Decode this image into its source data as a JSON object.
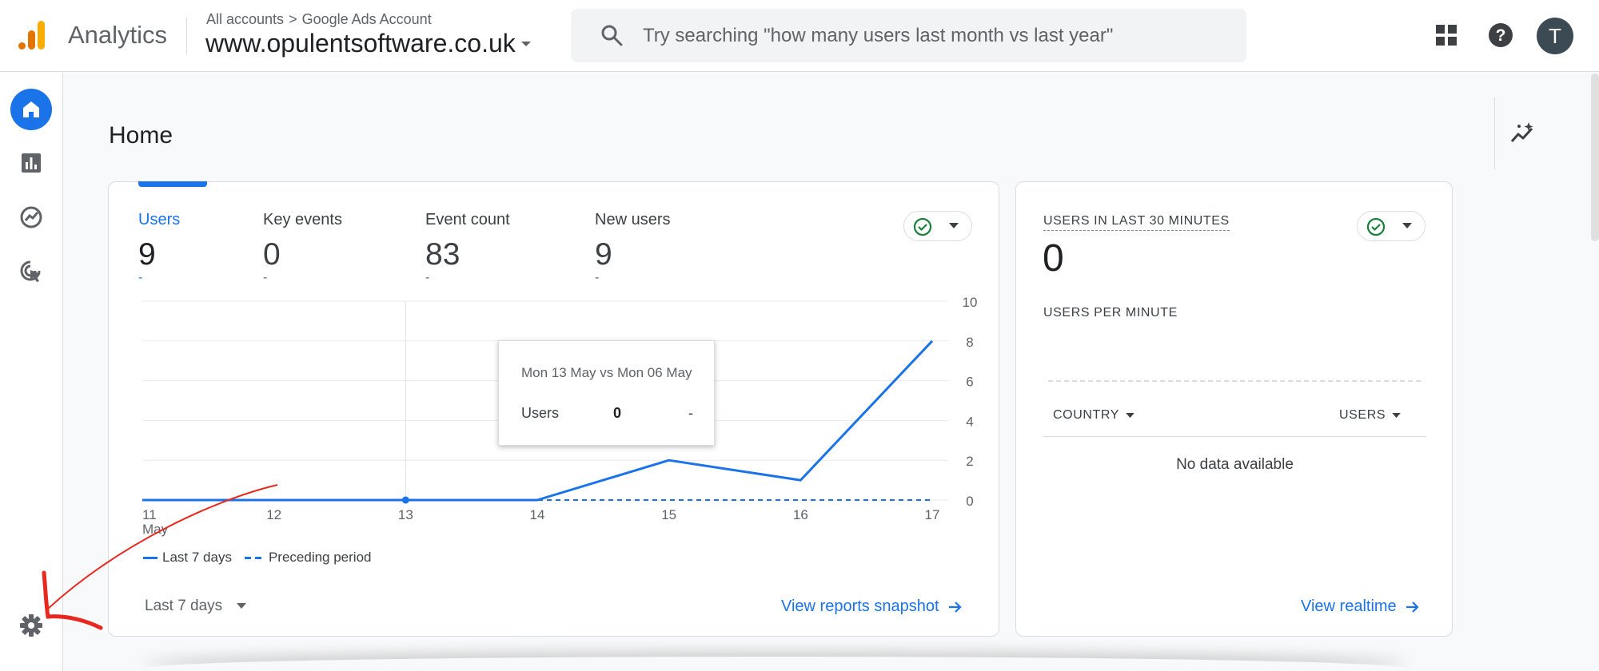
{
  "header": {
    "app_name": "Analytics",
    "breadcrumb_root": "All accounts",
    "breadcrumb_sep": ">",
    "breadcrumb_account": "Google Ads Account",
    "property": "www.opulentsoftware.co.uk",
    "search_placeholder": "Try searching \"how many users last month vs last year\"",
    "avatar_initial": "T",
    "icons": [
      "search-icon",
      "apps-grid-icon",
      "help-icon"
    ]
  },
  "leftnav": {
    "items": [
      {
        "icon": "home-icon",
        "active": true
      },
      {
        "icon": "reports-icon",
        "active": false
      },
      {
        "icon": "explore-icon",
        "active": false
      },
      {
        "icon": "advertising-icon",
        "active": false
      }
    ],
    "settings_icon": "gear-icon"
  },
  "page": {
    "title": "Home"
  },
  "main_card": {
    "metrics": [
      {
        "label": "Users",
        "value": "9",
        "delta": "-",
        "active": true
      },
      {
        "label": "Key events",
        "value": "0",
        "delta": "-",
        "active": false
      },
      {
        "label": "Event count",
        "value": "83",
        "delta": "-",
        "active": false
      },
      {
        "label": "New users",
        "value": "9",
        "delta": "-",
        "active": false
      }
    ],
    "tooltip": {
      "title": "Mon 13 May vs Mon 06 May",
      "row_label": "Users",
      "row_value": "0",
      "row_prev": "-"
    },
    "legend": {
      "current": "Last 7 days",
      "previous": "Preceding period"
    },
    "date_range": "Last 7 days",
    "link": "View reports snapshot"
  },
  "chart_data": {
    "type": "line",
    "x": [
      "11",
      "12",
      "13",
      "14",
      "15",
      "16",
      "17"
    ],
    "x_sublabel_first": "May",
    "y_ticks": [
      0,
      2,
      4,
      6,
      8,
      10
    ],
    "ylim": [
      0,
      10
    ],
    "series": [
      {
        "name": "Last 7 days",
        "values": [
          0,
          0,
          0,
          0,
          2,
          1,
          8
        ],
        "style": "solid",
        "color": "#1a73e8"
      },
      {
        "name": "Preceding period",
        "values": [
          0,
          0,
          0,
          0,
          0,
          0,
          0
        ],
        "style": "dashed",
        "color": "#1a73e8"
      }
    ],
    "highlight_index": 2
  },
  "realtime_card": {
    "label": "USERS IN LAST 30 MINUTES",
    "value": "0",
    "per_minute": "USERS PER MINUTE",
    "col_country": "COUNTRY",
    "col_users": "USERS",
    "no_data": "No data available",
    "link": "View realtime"
  },
  "colors": {
    "accent": "#1a73e8",
    "status_green": "#188038",
    "annotation": "#e8281e"
  }
}
